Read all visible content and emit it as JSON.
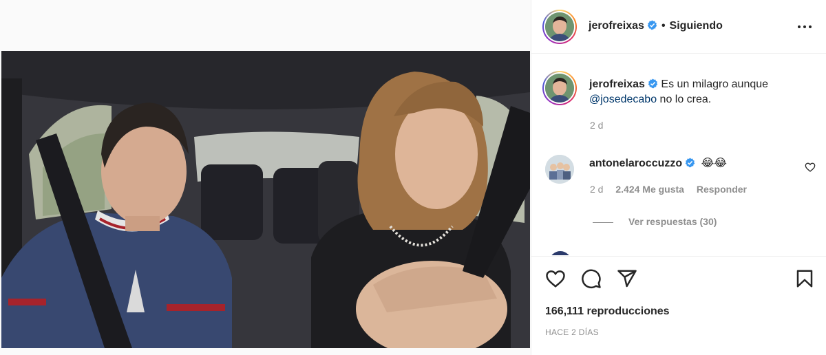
{
  "post": {
    "username": "jerofreixas",
    "follow_status": "Siguiendo",
    "separator": "•",
    "caption_before": "Es un milagro aunque ",
    "caption_mention": "@josedecabo",
    "caption_after": " no lo crea.",
    "caption_time": "2 d"
  },
  "comments": [
    {
      "username": "antonelaroccuzzo",
      "emoji": "😂😂",
      "time": "2 d",
      "likes": "2.424 Me gusta",
      "reply_label": "Responder",
      "view_replies": "Ver respuestas (30)"
    }
  ],
  "stats": {
    "views": "166,111 reproducciones",
    "posted": "HACE 2 DÍAS"
  },
  "icons": {
    "more": "more-options-icon",
    "verified": "verified-badge-icon",
    "like": "heart-icon",
    "comment": "comment-icon",
    "share": "paper-plane-icon",
    "save": "bookmark-icon"
  },
  "colors": {
    "verified": "#3897f0",
    "mention": "#00376b",
    "muted": "#8e8e8e",
    "text": "#262626"
  }
}
